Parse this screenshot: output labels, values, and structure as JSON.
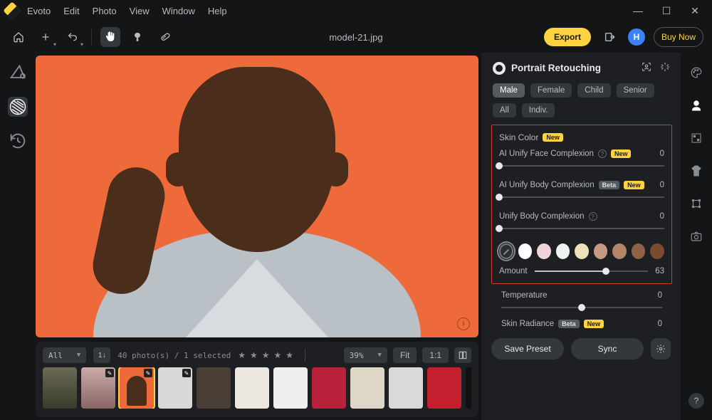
{
  "menu": {
    "items": [
      "Evoto",
      "Edit",
      "Photo",
      "View",
      "Window",
      "Help"
    ]
  },
  "titlebar": {
    "filename": "model-21.jpg"
  },
  "toolbar": {
    "export_label": "Export",
    "avatar_letter": "H",
    "buy_label": "Buy Now"
  },
  "filmstrip": {
    "filter_label": "All",
    "count_text": "40 photo(s) / 1 selected",
    "zoom_label": "39%",
    "fit_label": "Fit",
    "oneone_label": "1:1",
    "sort_glyph": "1↓"
  },
  "panel": {
    "title": "Portrait Retouching",
    "chips": [
      "Male",
      "Female",
      "Child",
      "Senior",
      "All",
      "Indiv."
    ],
    "active_chip_index": 0,
    "section_title": "Skin Color",
    "section_badge": "New",
    "sliders": [
      {
        "label": "AI Unify Face Complexion",
        "badges": [
          "New"
        ],
        "info": true,
        "value": 0
      },
      {
        "label": "AI Unify Body Complexion",
        "badges": [
          "Beta",
          "New"
        ],
        "info": false,
        "value": 0
      },
      {
        "label": "Unify Body Complexion",
        "badges": [],
        "info": true,
        "value": 0
      }
    ],
    "swatches": [
      "none",
      "#ffffff",
      "#f0d4d9",
      "#eef3f1",
      "#efe0bd",
      "#c79a86",
      "#b38566",
      "#8f6246",
      "#7b4b30"
    ],
    "amount_label": "Amount",
    "amount_value": 63,
    "temperature_label": "Temperature",
    "temperature_value": 0,
    "skin_radiance_label": "Skin Radiance",
    "skin_radiance_badges": [
      "Beta",
      "New"
    ],
    "save_preset_label": "Save Preset",
    "sync_label": "Sync"
  },
  "right_tools": [
    "palette",
    "face",
    "exposure",
    "clothing",
    "crop",
    "camera"
  ],
  "help_glyph": "?"
}
